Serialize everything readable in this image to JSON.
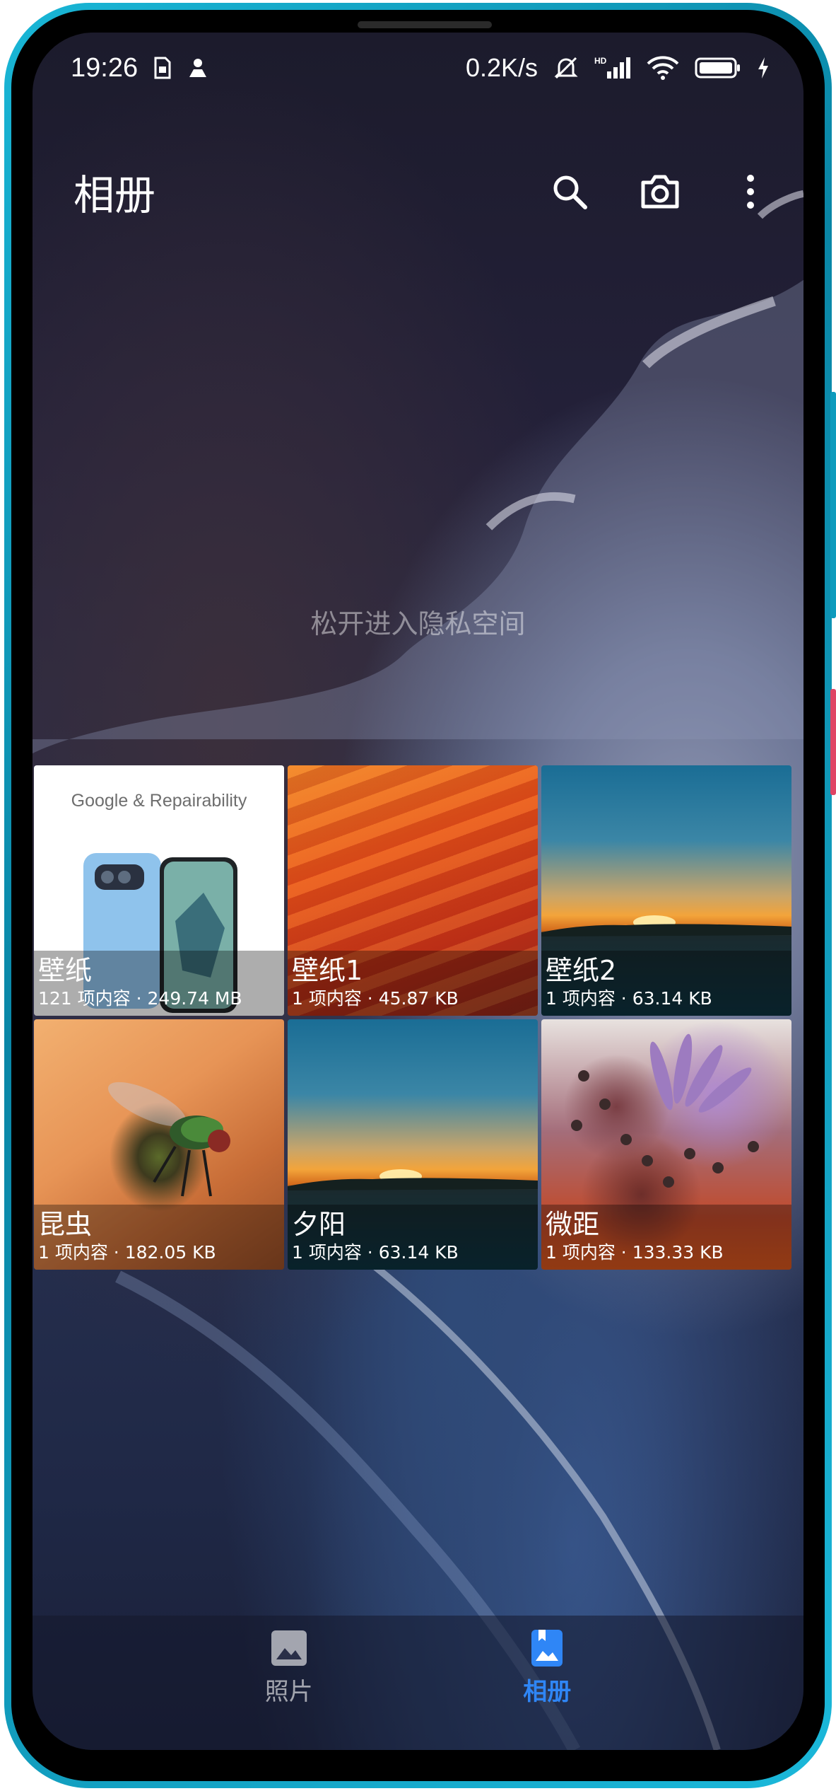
{
  "status_bar": {
    "time": "19:26",
    "net_speed": "0.2K/s",
    "icons": [
      "sim-icon",
      "person-icon",
      "mute-icon",
      "hd-signal-icon",
      "wifi-icon",
      "battery-icon",
      "charging-icon"
    ]
  },
  "app_bar": {
    "title": "相册",
    "actions": [
      "search-icon",
      "camera-icon",
      "more-icon"
    ]
  },
  "pull_hint": "松开进入隐私空间",
  "albums": [
    {
      "name": "壁纸",
      "meta": "121 项内容 · 249.74 MB",
      "thumb_text": "Google & Repairability"
    },
    {
      "name": "壁纸1",
      "meta": "1 项内容 · 45.87 KB"
    },
    {
      "name": "壁纸2",
      "meta": "1 项内容 · 63.14 KB"
    },
    {
      "name": "昆虫",
      "meta": "1 项内容 · 182.05 KB"
    },
    {
      "name": "夕阳",
      "meta": "1 项内容 · 63.14 KB"
    },
    {
      "name": "微距",
      "meta": "1 项内容 · 133.33 KB"
    }
  ],
  "bottom_nav": {
    "items": [
      {
        "label": "照片",
        "icon": "photo-icon",
        "active": false
      },
      {
        "label": "相册",
        "icon": "album-icon",
        "active": true
      }
    ],
    "active_color": "#2f86f6"
  }
}
